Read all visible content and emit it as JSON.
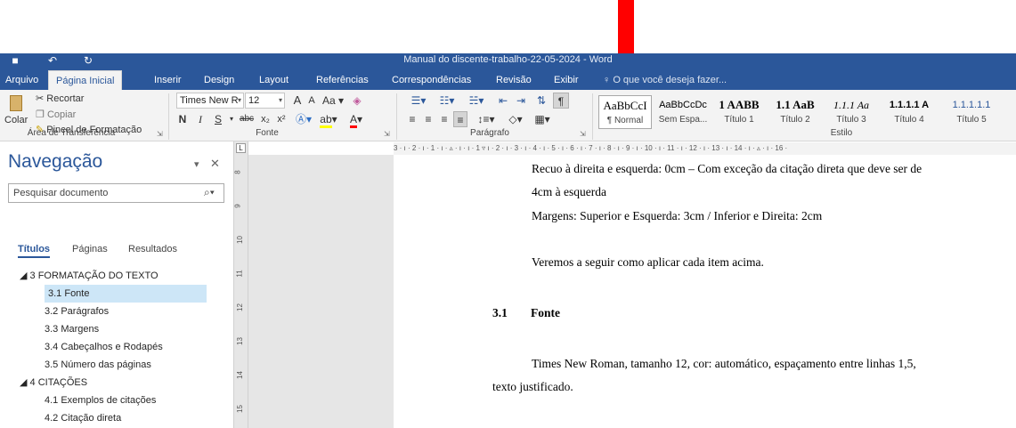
{
  "window": {
    "title": "Manual do discente-trabalho-22-05-2024 - Word"
  },
  "tabs": {
    "file": "Arquivo",
    "home": "Página Inicial",
    "insert": "Inserir",
    "design": "Design",
    "layout": "Layout",
    "references": "Referências",
    "mailings": "Correspondências",
    "review": "Revisão",
    "view": "Exibir",
    "tellme": "O que você deseja fazer..."
  },
  "clipboard": {
    "paste": "Colar",
    "cut": "Recortar",
    "copy": "Copiar",
    "format_painter": "Pincel de Formatação",
    "label": "Área de Transferência"
  },
  "font": {
    "name": "Times New R",
    "size": "12",
    "grow": "A",
    "shrink": "A",
    "case": "Aa",
    "bold": "N",
    "italic": "I",
    "underline": "S",
    "strike": "abc",
    "subscript": "x₂",
    "superscript": "x²",
    "label": "Fonte"
  },
  "paragraph": {
    "label": "Parágrafo",
    "pilcrow": "¶"
  },
  "styles": {
    "label": "Estilo",
    "items": [
      {
        "sample": "AaBbCcI",
        "name": "¶ Normal"
      },
      {
        "sample": "AaBbCcDc",
        "name": "Sem Espa..."
      },
      {
        "sample": "1 AABB",
        "name": "Título 1"
      },
      {
        "sample": "1.1 AaB",
        "name": "Título 2"
      },
      {
        "sample": "1.1.1 Aa",
        "name": "Título 3"
      },
      {
        "sample": "1.1.1.1 A",
        "name": "Título 4"
      },
      {
        "sample": "1.1.1.1.1",
        "name": "Título 5"
      }
    ]
  },
  "navigation": {
    "title": "Navegação",
    "search_placeholder": "Pesquisar documento",
    "tabs": [
      "Títulos",
      "Páginas",
      "Resultados"
    ],
    "tree": [
      {
        "label": "◢ 3 FORMATAÇÃO DO TEXTO",
        "level": 0
      },
      {
        "label": "3.1 Fonte",
        "level": 1,
        "selected": true
      },
      {
        "label": "3.2 Parágrafos",
        "level": 1
      },
      {
        "label": "3.3 Margens",
        "level": 1
      },
      {
        "label": "3.4 Cabeçalhos e Rodapés",
        "level": 1
      },
      {
        "label": "3.5 Número das páginas",
        "level": 1
      },
      {
        "label": "◢ 4 CITAÇÕES",
        "level": 0
      },
      {
        "label": "4.1 Exemplos de citações",
        "level": 1
      },
      {
        "label": "4.2 Citação direta",
        "level": 1
      }
    ]
  },
  "ruler": {
    "text": "3 · ı · 2 · ı · 1 · ı · ▵ · ı · ı · 1 ▿ ı · 2 · ı · 3 · ı · 4 · ı · 5 · ı · 6 · ı · 7 · ı · 8 · ı · 9 · ı · 10 · ı · 11 · ı · 12 · ı · 13 · ı · 14 · ı · ▵ · ı · 16 ·",
    "vertical": [
      "8",
      "9",
      "10",
      "11",
      "12",
      "13",
      "14",
      "15"
    ]
  },
  "document": {
    "line1": "Recuo à direita e esquerda: 0cm – Com exceção da citação direta que deve ser de",
    "line2": "4cm à esquerda",
    "line3": "Margens: Superior e Esquerda: 3cm / Inferior e Direita: 2cm",
    "line4": "Veremos a seguir como aplicar cada item acima.",
    "heading_number": "3.1",
    "heading_text": "Fonte",
    "line5": "Times New Roman, tamanho 12, cor: automático, espaçamento entre linhas 1,5,",
    "line6": "texto justificado."
  },
  "colors": {
    "accent": "#2b579a",
    "annotation_arrow": "#ff0000"
  }
}
